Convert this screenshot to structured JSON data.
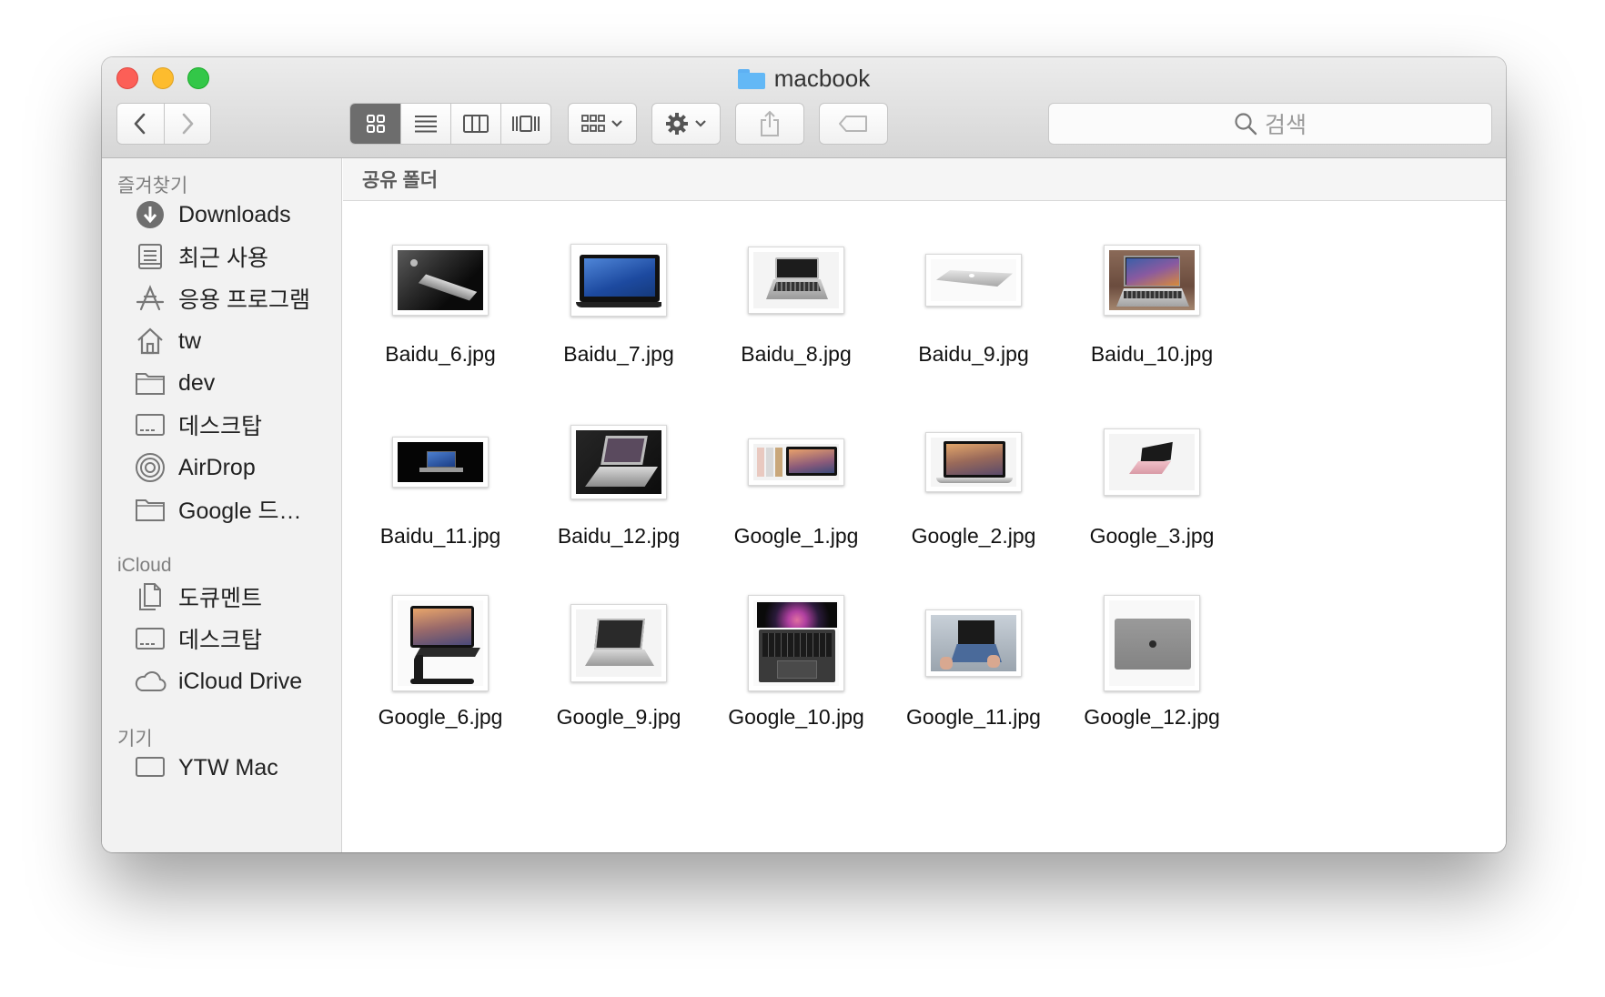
{
  "window": {
    "title": "macbook"
  },
  "toolbar": {
    "search_placeholder": "검색"
  },
  "sidebar": {
    "sections": [
      {
        "title": "즐겨찾기",
        "items": [
          {
            "label": "Downloads",
            "icon": "downloads-icon"
          },
          {
            "label": "최근 사용",
            "icon": "recents-icon"
          },
          {
            "label": "응용 프로그램",
            "icon": "applications-icon"
          },
          {
            "label": "tw",
            "icon": "home-icon"
          },
          {
            "label": "dev",
            "icon": "folder-icon"
          },
          {
            "label": "데스크탑",
            "icon": "desktop-icon"
          },
          {
            "label": "AirDrop",
            "icon": "airdrop-icon"
          },
          {
            "label": "Google 드…",
            "icon": "folder-icon"
          }
        ]
      },
      {
        "title": "iCloud",
        "items": [
          {
            "label": "도큐멘트",
            "icon": "documents-icon"
          },
          {
            "label": "데스크탑",
            "icon": "desktop-icon"
          },
          {
            "label": "iCloud Drive",
            "icon": "cloud-icon"
          }
        ]
      },
      {
        "title": "기기",
        "items": [
          {
            "label": "YTW Mac",
            "icon": "computer-icon"
          }
        ]
      }
    ]
  },
  "pathbar": {
    "label": "공유 폴더"
  },
  "files": [
    {
      "name": "Baidu_6.jpg"
    },
    {
      "name": "Baidu_7.jpg"
    },
    {
      "name": "Baidu_8.jpg"
    },
    {
      "name": "Baidu_9.jpg"
    },
    {
      "name": "Baidu_10.jpg"
    },
    {
      "name": "Baidu_11.jpg"
    },
    {
      "name": "Baidu_12.jpg"
    },
    {
      "name": "Google_1.jpg"
    },
    {
      "name": "Google_2.jpg"
    },
    {
      "name": "Google_3.jpg"
    },
    {
      "name": "Google_6.jpg"
    },
    {
      "name": "Google_9.jpg"
    },
    {
      "name": "Google_10.jpg"
    },
    {
      "name": "Google_11.jpg"
    },
    {
      "name": "Google_12.jpg"
    }
  ]
}
